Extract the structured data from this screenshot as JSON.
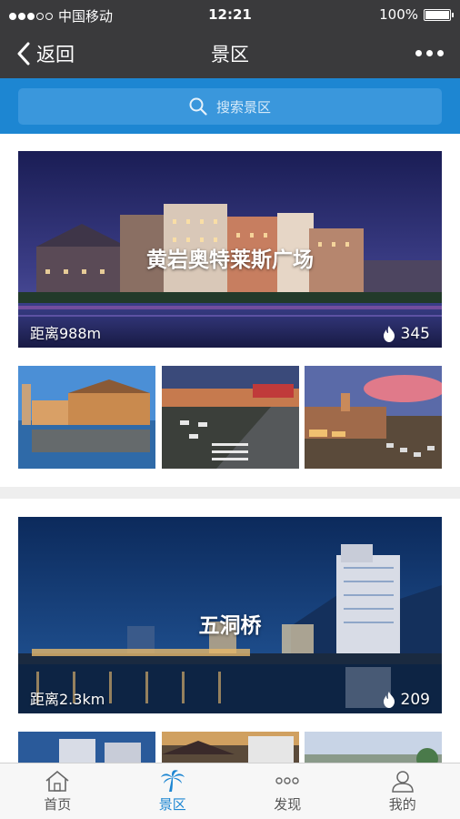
{
  "status_bar": {
    "carrier": "中国移动",
    "time": "12:21",
    "battery": "100%"
  },
  "nav": {
    "back_label": "返回",
    "title": "景区"
  },
  "search": {
    "placeholder": "搜索景区"
  },
  "spots": [
    {
      "name": "黄岩奥特莱斯广场",
      "distance": "距离988m",
      "hot": "345"
    },
    {
      "name": "五洞桥",
      "distance": "距离2.3km",
      "hot": "209"
    }
  ],
  "tabs": [
    {
      "label": "首页",
      "icon": "home-icon"
    },
    {
      "label": "景区",
      "icon": "palm-tree-icon"
    },
    {
      "label": "发现",
      "icon": "dots-icon"
    },
    {
      "label": "我的",
      "icon": "user-icon"
    }
  ],
  "colors": {
    "accent": "#1d86d2",
    "nav_bg": "#3a3a3c"
  }
}
